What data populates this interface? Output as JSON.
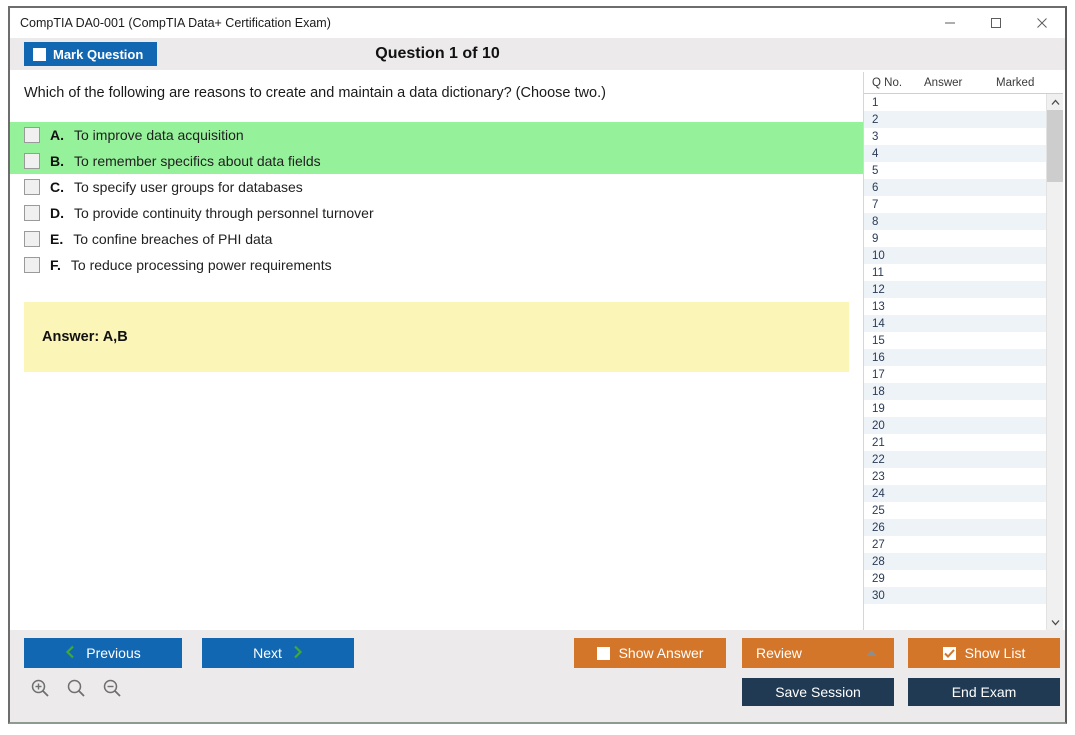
{
  "window": {
    "title": "CompTIA DA0-001 (CompTIA Data+ Certification Exam)",
    "minimize_icon": "minimize-icon",
    "maximize_icon": "maximize-icon",
    "close_icon": "close-icon"
  },
  "header": {
    "mark_question_label": "Mark Question",
    "question_counter": "Question 1 of 10",
    "mark_question_checked": false
  },
  "question": {
    "text": "Which of the following are reasons to create and maintain a data dictionary? (Choose two.)",
    "options": [
      {
        "letter": "A.",
        "text": "To improve data acquisition",
        "correct": true
      },
      {
        "letter": "B.",
        "text": "To remember specifics about data fields",
        "correct": true
      },
      {
        "letter": "C.",
        "text": "To specify user groups for databases",
        "correct": false
      },
      {
        "letter": "D.",
        "text": "To provide continuity through personnel turnover",
        "correct": false
      },
      {
        "letter": "E.",
        "text": "To confine breaches of PHI data",
        "correct": false
      },
      {
        "letter": "F.",
        "text": "To reduce processing power requirements",
        "correct": false
      }
    ],
    "answer_label": "Answer: A,B"
  },
  "question_list": {
    "columns": [
      "Q No.",
      "Answer",
      "Marked"
    ],
    "rows": [
      {
        "no": "1",
        "answer": "",
        "marked": ""
      },
      {
        "no": "2",
        "answer": "",
        "marked": ""
      },
      {
        "no": "3",
        "answer": "",
        "marked": ""
      },
      {
        "no": "4",
        "answer": "",
        "marked": ""
      },
      {
        "no": "5",
        "answer": "",
        "marked": ""
      },
      {
        "no": "6",
        "answer": "",
        "marked": ""
      },
      {
        "no": "7",
        "answer": "",
        "marked": ""
      },
      {
        "no": "8",
        "answer": "",
        "marked": ""
      },
      {
        "no": "9",
        "answer": "",
        "marked": ""
      },
      {
        "no": "10",
        "answer": "",
        "marked": ""
      },
      {
        "no": "11",
        "answer": "",
        "marked": ""
      },
      {
        "no": "12",
        "answer": "",
        "marked": ""
      },
      {
        "no": "13",
        "answer": "",
        "marked": ""
      },
      {
        "no": "14",
        "answer": "",
        "marked": ""
      },
      {
        "no": "15",
        "answer": "",
        "marked": ""
      },
      {
        "no": "16",
        "answer": "",
        "marked": ""
      },
      {
        "no": "17",
        "answer": "",
        "marked": ""
      },
      {
        "no": "18",
        "answer": "",
        "marked": ""
      },
      {
        "no": "19",
        "answer": "",
        "marked": ""
      },
      {
        "no": "20",
        "answer": "",
        "marked": ""
      },
      {
        "no": "21",
        "answer": "",
        "marked": ""
      },
      {
        "no": "22",
        "answer": "",
        "marked": ""
      },
      {
        "no": "23",
        "answer": "",
        "marked": ""
      },
      {
        "no": "24",
        "answer": "",
        "marked": ""
      },
      {
        "no": "25",
        "answer": "",
        "marked": ""
      },
      {
        "no": "26",
        "answer": "",
        "marked": ""
      },
      {
        "no": "27",
        "answer": "",
        "marked": ""
      },
      {
        "no": "28",
        "answer": "",
        "marked": ""
      },
      {
        "no": "29",
        "answer": "",
        "marked": ""
      },
      {
        "no": "30",
        "answer": "",
        "marked": ""
      }
    ],
    "scroll_up_icon": "chevron-up-icon",
    "scroll_down_icon": "chevron-down-icon"
  },
  "footer": {
    "previous_label": "Previous",
    "next_label": "Next",
    "show_answer_label": "Show Answer",
    "show_answer_checked": false,
    "review_label": "Review",
    "show_list_label": "Show List",
    "show_list_checked": true,
    "save_session_label": "Save Session",
    "end_exam_label": "End Exam",
    "zoom_in_icon": "zoom-in-icon",
    "zoom_reset_icon": "zoom-reset-icon",
    "zoom_out_icon": "zoom-out-icon"
  },
  "colors": {
    "accent_blue": "#1267b2",
    "accent_orange": "#d4762a",
    "navy": "#1f3a52",
    "correct_green": "#96f29a",
    "answer_yellow": "#fbf5b7",
    "chevron_green": "#3faa35"
  }
}
